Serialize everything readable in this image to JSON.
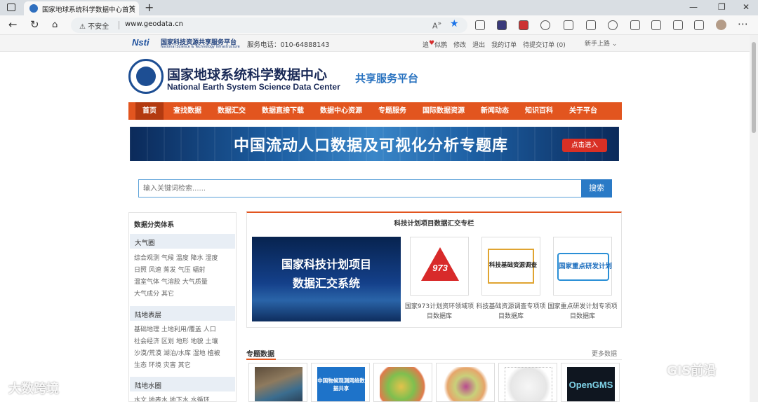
{
  "browser": {
    "tab_title": "国家地球系统科学数据中心首页",
    "tab_close": "×",
    "new_tab": "+",
    "insecure_label": "⚠ 不安全",
    "url": "www.geodata.cn",
    "window_controls": [
      "—",
      "❐",
      "✕"
    ]
  },
  "site_top": {
    "nsti_logo": "Nsti",
    "nsti_title": "国家科技资源共享服务平台",
    "nsti_subtitle": "National Science & Technology Infrastructure",
    "hotline": "服务电话：010-64888143",
    "links": [
      "追",
      "♥",
      "似鹊",
      "修改",
      "退出",
      "我的订单",
      "待提交订单 (0)"
    ],
    "newbie": "新手上路 ⌄"
  },
  "header": {
    "title_cn": "国家地球系统科学数据中心",
    "title_en": "National Earth System Science Data Center",
    "platform": "共享服务平台"
  },
  "nav": [
    "首页",
    "查找数据",
    "数据汇交",
    "数据直接下载",
    "数据中心资源",
    "专题服务",
    "国际数据资源",
    "新闻动态",
    "知识百科",
    "关于平台"
  ],
  "banner": {
    "text": "中国流动人口数据及可视化分析专题库",
    "button": "点击进入"
  },
  "search": {
    "placeholder": "输入关键词检索......",
    "button": "搜索"
  },
  "sidebar": {
    "title": "数据分类体系",
    "categories": [
      {
        "name": "大气圈",
        "lines": [
          "综合观测  气候  温度  降水  湿度",
          "日照  风速  蒸发  气压  辐射",
          "温室气体  气溶胶  大气质量",
          "大气成分  其它"
        ]
      },
      {
        "name": "陆地表层",
        "lines": [
          "基础地理  土地利用/覆盖  人口",
          "社会经济  区划  地形  地貌  土壤",
          "沙漠/荒漠  湖泊/水库  湿地  植被",
          "生态  环境  灾害  其它"
        ]
      },
      {
        "name": "陆地水圈",
        "lines": [
          "水文  地表水  地下水  水循环"
        ]
      }
    ]
  },
  "projects": {
    "title": "科技计划项目数据汇交专栏",
    "big_card": [
      "国家科技计划项目",
      "数据汇交系统"
    ],
    "cards": [
      {
        "image_text": "973",
        "label": "国家973计划资环领域项目数据库"
      },
      {
        "image_text": "科技基础资源调查",
        "label": "科技基础资源调查专项项目数据库"
      },
      {
        "image_text": "国家重点研发计划",
        "label": "国家重点研发计划专项项目数据库"
      }
    ]
  },
  "thematic": {
    "title": "专题数据",
    "more": "更多数据",
    "cards": [
      "",
      "中国物候观测网络数据共享",
      "",
      "",
      "",
      "OpenGMS"
    ]
  },
  "watermarks": {
    "left": "大数跨境",
    "right": "GIS前沿"
  }
}
